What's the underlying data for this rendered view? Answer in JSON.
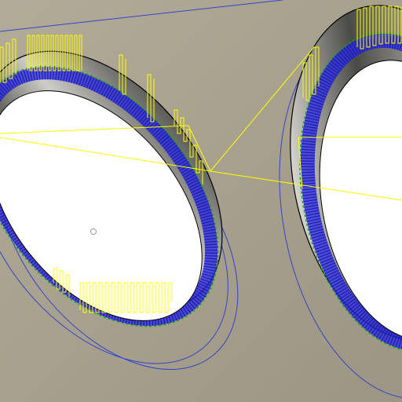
{
  "viewport": {
    "background": "#9c9583",
    "background_light": "#b2ab98",
    "hole_fill": "#ffffff",
    "wall_dark": "#3a3a38",
    "wall_light": "#d4d2cc"
  },
  "colors": {
    "cut_pass": "#2a2ad8",
    "cut_pass_stroke": "#1a1ac0",
    "link_move": "#00b400",
    "rapid_move": "#ffff00",
    "boundary": "#3344cc",
    "edge": "#000000",
    "origin": "#a09b8c"
  },
  "features": [
    {
      "id": "hole-left"
    },
    {
      "id": "hole-right"
    }
  ]
}
